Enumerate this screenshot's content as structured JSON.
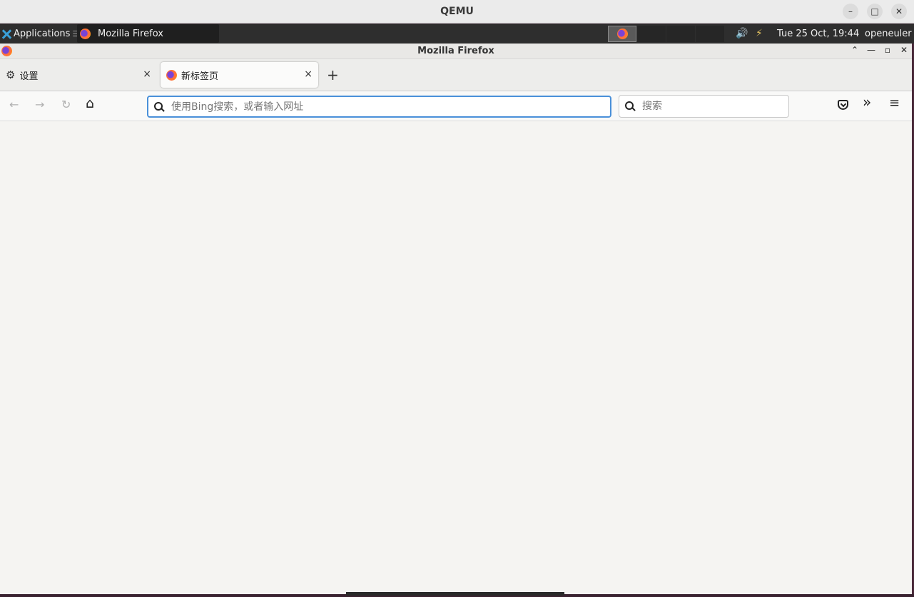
{
  "qemu": {
    "title": "QEMU",
    "minimize": "–",
    "maximize": "□",
    "close": "✕"
  },
  "panel": {
    "applications_label": "Applications",
    "applications_sep": "☰",
    "task_label": "Mozilla Firefox",
    "clock": "Tue 25 Oct, 19:44",
    "user": "openeuler",
    "volume_icon": "🔊",
    "network_icon": "⚡"
  },
  "firefox": {
    "window_title": "Mozilla Firefox",
    "win_up": "⌃",
    "win_min": "—",
    "win_max": "▫",
    "win_close": "✕",
    "tabs": [
      {
        "label": "设置",
        "close": "×"
      },
      {
        "label": "新标签页",
        "close": "×"
      }
    ],
    "new_tab": "+",
    "nav": {
      "back": "←",
      "forward": "→",
      "reload": "↻",
      "home": "⌂"
    },
    "urlbar": {
      "placeholder": "使用Bing搜索，或者输入网址"
    },
    "searchbar": {
      "placeholder": "搜索"
    },
    "toolbar": {
      "overflow": "»",
      "menu": "≡"
    }
  },
  "colors": {
    "urlbar_focus": "#4a90d9",
    "panel_bg": "#2e2e2e",
    "content_bg": "#f5f4f2"
  }
}
